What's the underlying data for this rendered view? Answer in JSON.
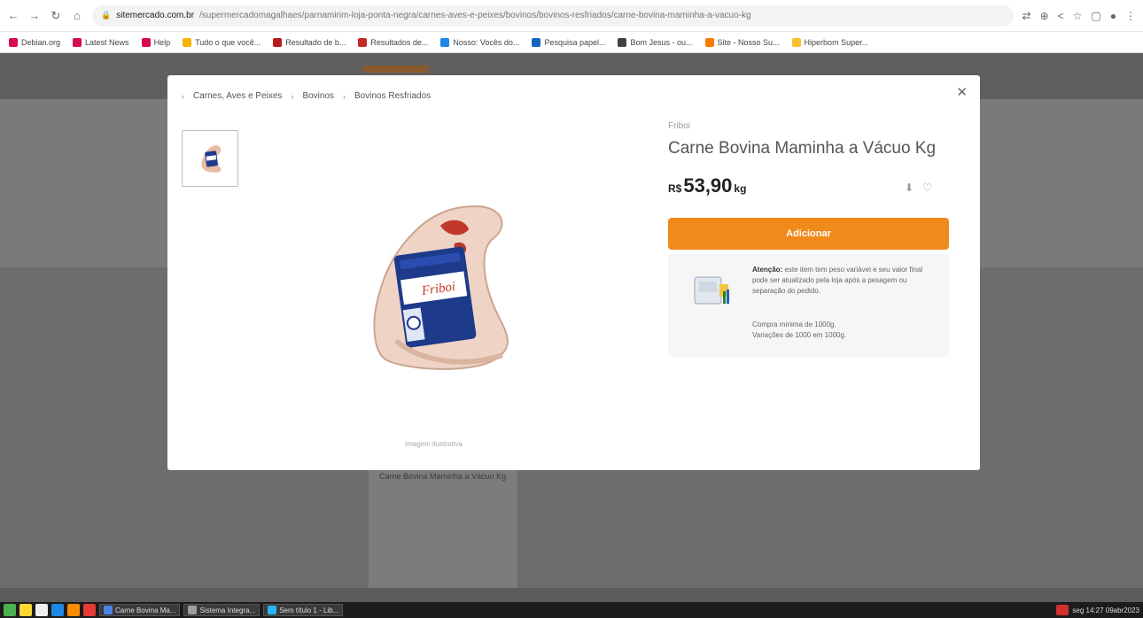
{
  "browser": {
    "url_host": "sitemercado.com.br",
    "url_path": "/supermercadomagalhaes/parnamirim-loja-ponta-negra/carnes-aves-e-peixes/bovinos/bovinos-resfriados/carne-bovina-maminha-a-vacuo-kg",
    "bookmarks": [
      {
        "label": "Debian.org",
        "color": "#d70a53"
      },
      {
        "label": "Latest News",
        "color": "#d70a53"
      },
      {
        "label": "Help",
        "color": "#d70a53"
      },
      {
        "label": "Tudo o que você...",
        "color": "#f4b400"
      },
      {
        "label": "Resultado de b...",
        "color": "#b71c1c"
      },
      {
        "label": "Resultados de...",
        "color": "#c62828"
      },
      {
        "label": "Nosso: Vocês do...",
        "color": "#1e88e5"
      },
      {
        "label": "Pesquisa papel...",
        "color": "#1565c0"
      },
      {
        "label": "Bom Jesus - ou...",
        "color": "#424242"
      },
      {
        "label": "Site - Nosso Su...",
        "color": "#f57c00"
      },
      {
        "label": "Hiperbom Super...",
        "color": "#fbc02d"
      }
    ]
  },
  "background_page": {
    "card_text": "Carne Bovina Maminha a Vácuo Kg"
  },
  "modal": {
    "breadcrumb": [
      "Carnes, Aves e Peixes",
      "Bovinos",
      "Bovinos Resfriados"
    ],
    "brand": "Friboi",
    "title": "Carne Bovina Maminha a Vácuo Kg",
    "price": {
      "currency": "R$",
      "value": "53,90",
      "unit": "kg"
    },
    "add_button": "Adicionar",
    "info": {
      "bold": "Atenção:",
      "text": "este item tem peso variável e seu valor final pode ser atualizado pela loja após a pesagem ou separação do pedido.",
      "min": "Compra mínima de 1000g.",
      "step": "Variações de 1000 em 1000g."
    },
    "image_caption": "Imagem ilustrativa",
    "accent_color": "#f08a1b"
  },
  "taskbar": {
    "tasks": [
      "Carne Bovina Ma...",
      "Sistema Integra...",
      "Sem título 1 - Lib..."
    ],
    "clock": "seg 14:27 09abr2023"
  }
}
